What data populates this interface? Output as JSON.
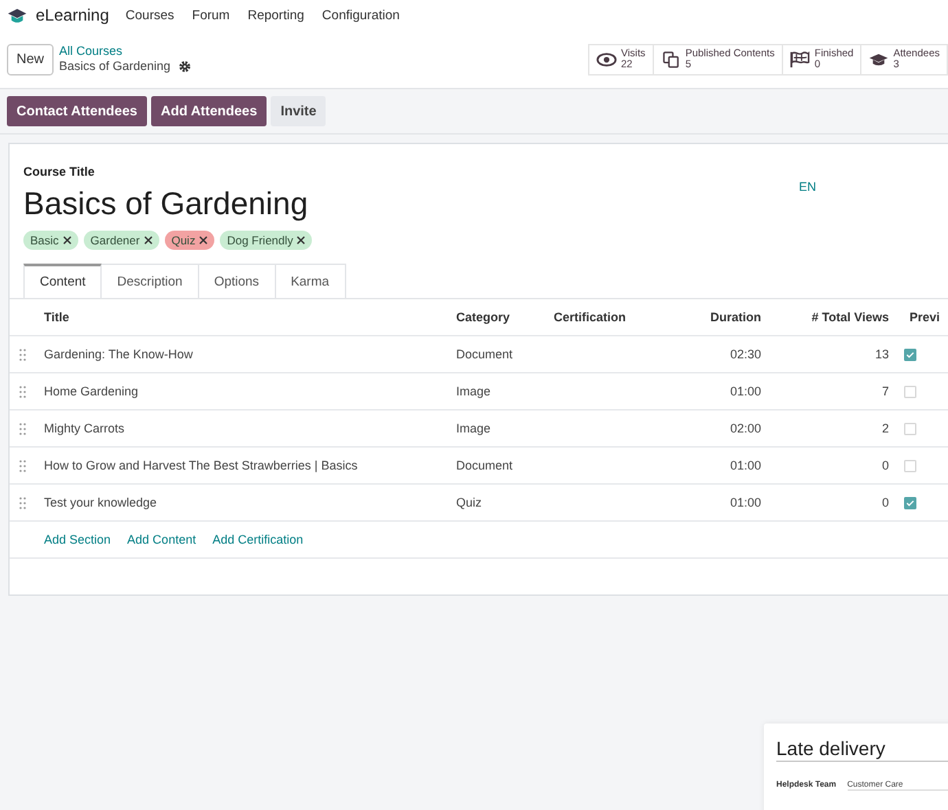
{
  "navbar": {
    "app_name": "eLearning",
    "menu": [
      "Courses",
      "Forum",
      "Reporting",
      "Configuration"
    ]
  },
  "control_panel": {
    "new_button": "New",
    "breadcrumb": {
      "parent": "All Courses",
      "current": "Basics of Gardening"
    },
    "stats": [
      {
        "kind": "eye",
        "label": "Visits",
        "value": "22"
      },
      {
        "kind": "copies",
        "label": "Published Contents",
        "value": "5"
      },
      {
        "kind": "flag",
        "label": "Finished",
        "value": "0"
      },
      {
        "kind": "cap",
        "label": "Attendees",
        "value": "3"
      }
    ]
  },
  "actions": [
    {
      "kind": "primary",
      "label": "Contact Attendees"
    },
    {
      "kind": "primary",
      "label": "Add Attendees"
    },
    {
      "kind": "secondary",
      "label": "Invite"
    }
  ],
  "form": {
    "field_label": "Course Title",
    "title": "Basics of Gardening",
    "language": "EN",
    "tags": [
      {
        "label": "Basic",
        "color": "#c9ecd2"
      },
      {
        "label": "Gardener",
        "color": "#c9ecd2"
      },
      {
        "label": "Quiz",
        "color": "#f2a2a2"
      },
      {
        "label": "Dog Friendly",
        "color": "#c9ecd2"
      }
    ],
    "tabs": [
      {
        "label": "Content",
        "selected": true
      },
      {
        "label": "Description",
        "selected": false
      },
      {
        "label": "Options",
        "selected": false
      },
      {
        "label": "Karma",
        "selected": false
      }
    ],
    "table": {
      "columns": [
        "Title",
        "Category",
        "Certification",
        "Duration",
        "# Total Views",
        "Previ"
      ],
      "rows": [
        {
          "title": "Gardening: The Know-How",
          "category": "Document",
          "duration": "02:30",
          "views": "13",
          "preview": true
        },
        {
          "title": "Home Gardening",
          "category": "Image",
          "duration": "01:00",
          "views": "7",
          "preview": false
        },
        {
          "title": "Mighty Carrots",
          "category": "Image",
          "duration": "02:00",
          "views": "2",
          "preview": false
        },
        {
          "title": "How to Grow and Harvest The Best Strawberries | Basics",
          "category": "Document",
          "duration": "01:00",
          "views": "0",
          "preview": false
        },
        {
          "title": "Test your knowledge",
          "category": "Quiz",
          "duration": "01:00",
          "views": "0",
          "preview": true
        }
      ],
      "add_links": [
        "Add Section",
        "Add Content",
        "Add Certification"
      ]
    }
  },
  "popup_card": {
    "title": "Late delivery",
    "fields": [
      {
        "label": "Helpdesk Team",
        "value": "Customer Care"
      }
    ]
  }
}
